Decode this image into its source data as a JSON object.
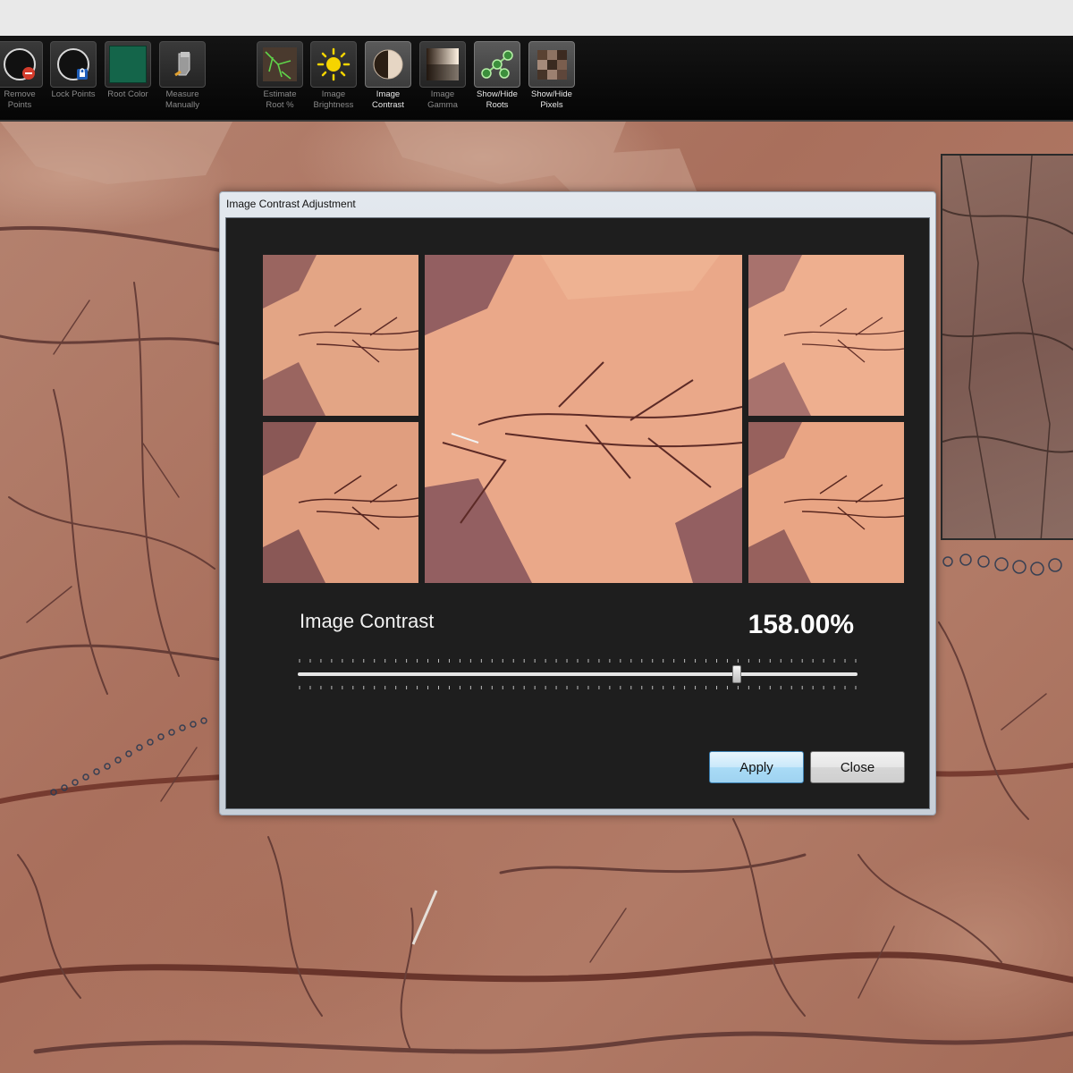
{
  "toolbar": {
    "tools": [
      {
        "label": "Remove\nPoints",
        "icon": "remove-points-icon"
      },
      {
        "label": "Lock Points",
        "icon": "lock-points-icon"
      },
      {
        "label": "Root Color",
        "icon": "root-color-swatch",
        "color": "#14654a"
      },
      {
        "label": "Measure\nManually",
        "icon": "measure-manually-icon"
      },
      {
        "label": "Estimate\nRoot %",
        "icon": "estimate-root-icon"
      },
      {
        "label": "Image\nBrightness",
        "icon": "brightness-icon"
      },
      {
        "label": "Image\nContrast",
        "icon": "contrast-icon"
      },
      {
        "label": "Image\nGamma",
        "icon": "gamma-icon"
      },
      {
        "label": "Show/Hide\nRoots",
        "icon": "show-hide-roots-icon"
      },
      {
        "label": "Show/Hide\nPixels",
        "icon": "show-hide-pixels-icon"
      }
    ]
  },
  "dialog": {
    "title": "Image Contrast Adjustment",
    "contrast_label": "Image Contrast",
    "contrast_value": "158.00%",
    "slider_fraction": 0.785,
    "apply_label": "Apply",
    "close_label": "Close"
  },
  "colors": {
    "toolbar_bg": "#0c0c0c",
    "dialog_bg": "#1e1e1e",
    "apply_accent": "#a9dbf6",
    "root_color": "#14654a"
  }
}
